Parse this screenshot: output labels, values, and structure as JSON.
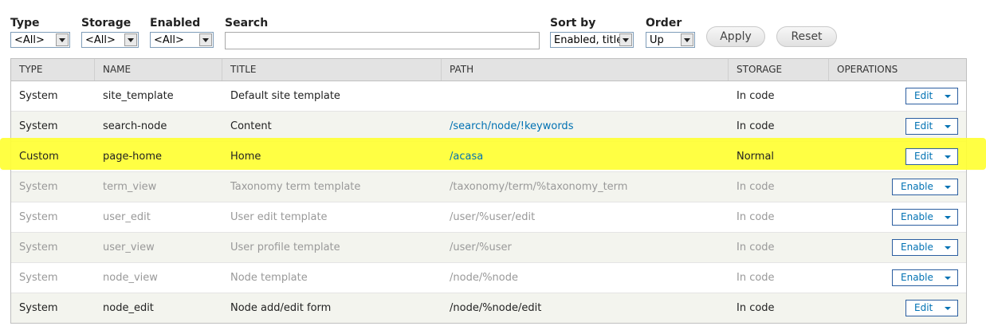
{
  "filters": {
    "type": {
      "label": "Type",
      "value": "<All>"
    },
    "storage": {
      "label": "Storage",
      "value": "<All>"
    },
    "enabled": {
      "label": "Enabled",
      "value": "<All>"
    },
    "search": {
      "label": "Search",
      "value": ""
    },
    "sort_by": {
      "label": "Sort by",
      "value": "Enabled, title"
    },
    "order": {
      "label": "Order",
      "value": "Up"
    },
    "apply_label": "Apply",
    "reset_label": "Reset"
  },
  "table": {
    "headers": [
      "TYPE",
      "NAME",
      "TITLE",
      "PATH",
      "STORAGE",
      "OPERATIONS"
    ],
    "rows": [
      {
        "type": "System",
        "name": "site_template",
        "title": "Default site template",
        "path": "",
        "storage": "In code",
        "op": "Edit",
        "enabled": true
      },
      {
        "type": "System",
        "name": "search-node",
        "title": "Content",
        "path": "/search/node/!keywords",
        "storage": "In code",
        "op": "Edit",
        "enabled": true
      },
      {
        "type": "Custom",
        "name": "page-home",
        "title": "Home",
        "path": "/acasa",
        "storage": "Normal",
        "op": "Edit",
        "enabled": true
      },
      {
        "type": "System",
        "name": "term_view",
        "title": "Taxonomy term template",
        "path": "/taxonomy/term/%taxonomy_term",
        "storage": "In code",
        "op": "Enable",
        "enabled": false
      },
      {
        "type": "System",
        "name": "user_edit",
        "title": "User edit template",
        "path": "/user/%user/edit",
        "storage": "In code",
        "op": "Enable",
        "enabled": false
      },
      {
        "type": "System",
        "name": "user_view",
        "title": "User profile template",
        "path": "/user/%user",
        "storage": "In code",
        "op": "Enable",
        "enabled": false
      },
      {
        "type": "System",
        "name": "node_view",
        "title": "Node template",
        "path": "/node/%node",
        "storage": "In code",
        "op": "Enable",
        "enabled": false
      },
      {
        "type": "System",
        "name": "node_edit",
        "title": "Node add/edit form",
        "path": "/node/%node/edit",
        "storage": "In code",
        "op": "Edit",
        "enabled": true
      }
    ]
  },
  "colors": {
    "highlight": "#ffff33",
    "link": "#0071b3",
    "disabled_text": "#999999",
    "header_bg": "#e3e3e3"
  }
}
